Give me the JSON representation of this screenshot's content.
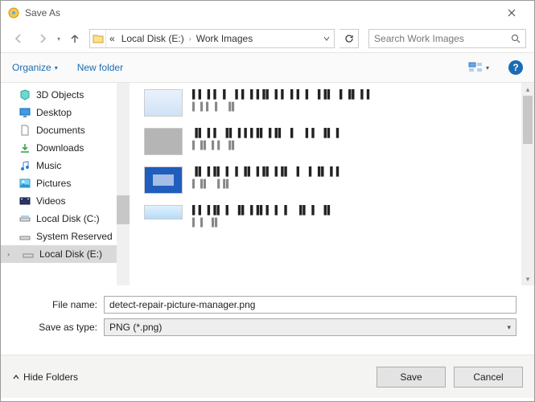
{
  "window": {
    "title": "Save As"
  },
  "nav": {
    "path_segments": [
      "«",
      "Local Disk (E:)",
      "Work Images"
    ],
    "search_placeholder": "Search Work Images"
  },
  "toolbar": {
    "organize": "Organize",
    "new_folder": "New folder"
  },
  "tree": [
    {
      "icon": "cube",
      "label": "3D Objects"
    },
    {
      "icon": "desktop",
      "label": "Desktop"
    },
    {
      "icon": "doc",
      "label": "Documents"
    },
    {
      "icon": "download",
      "label": "Downloads"
    },
    {
      "icon": "music",
      "label": "Music"
    },
    {
      "icon": "pictures",
      "label": "Pictures"
    },
    {
      "icon": "video",
      "label": "Videos"
    },
    {
      "icon": "drive",
      "label": "Local Disk (C:)"
    },
    {
      "icon": "drive2",
      "label": "System Reserved"
    },
    {
      "icon": "drive2",
      "label": "Local Disk (E:)",
      "selected": true,
      "expandable": true
    }
  ],
  "files": [
    {
      "name": "▌▌▐▐ ▌ ▌▌▐▐▐▌▐▐  ▌▌▐ ▐▐▌ ▌▐▌▐▐",
      "meta": "▌▐▐ ▌ ▐▌",
      "thumb": "light1"
    },
    {
      "name": "▐▌▐▐ ▐▌▐▐▐▐▌▐▐▌ ▌ ▐▐  ▐▌▐",
      "meta": "▌▐▌▐▐  ▐▌",
      "thumb": "gray"
    },
    {
      "name": "▐▌▐▐▌▐  ▌▐▌▐▐▌▐▐▌ ▌ ▌▐▌▐▐",
      "meta": "▌▐▌  ▐▐▌",
      "thumb": "blue"
    },
    {
      "name": "▌▌▐▐▌▐  ▐▌▐▐▌▌▐  ▌ ▐▌▐ ▐▌",
      "meta": "▌▐  ▐▌",
      "thumb": "light2"
    }
  ],
  "form": {
    "filename_label": "File name:",
    "filename_value": "detect-repair-picture-manager.png",
    "type_label": "Save as type:",
    "type_value": "PNG (*.png)"
  },
  "footer": {
    "hide_folders": "Hide Folders",
    "save": "Save",
    "cancel": "Cancel"
  }
}
